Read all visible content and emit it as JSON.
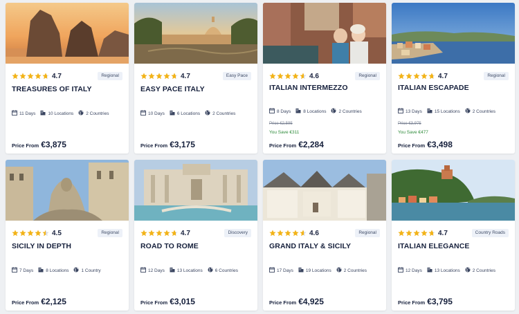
{
  "tours": [
    {
      "title": "TREASURES OF ITALY",
      "rating": "4.7",
      "tag": "Regional",
      "days": "11 Days",
      "locations": "10 Locations",
      "countries": "2 Countries",
      "price_label": "Price From",
      "price": "€3,875",
      "photo_alt": "sea-stacks-sunset"
    },
    {
      "title": "EASY PACE ITALY",
      "rating": "4.7",
      "tag": "Easy Pace",
      "days": "10 Days",
      "locations": "6 Locations",
      "countries": "2 Countries",
      "price_label": "Price From",
      "price": "€3,175",
      "photo_alt": "rome-river-dome"
    },
    {
      "title": "ITALIAN INTERMEZZO",
      "rating": "4.6",
      "tag": "Regional",
      "days": "8 Days",
      "locations": "8 Locations",
      "countries": "2 Countries",
      "was_price": "Price €2,595",
      "save": "You Save €311",
      "price_label": "Price From",
      "price": "€2,284",
      "photo_alt": "venice-canal-travelers"
    },
    {
      "title": "ITALIAN ESCAPADE",
      "rating": "4.7",
      "tag": "Regional",
      "days": "13 Days",
      "locations": "15 Locations",
      "countries": "2 Countries",
      "was_price": "Price €3,975",
      "save": "You Save €477",
      "price_label": "Price From",
      "price": "€3,498",
      "photo_alt": "coastal-town"
    },
    {
      "title": "SICILY IN DEPTH",
      "rating": "4.5",
      "tag": "Regional",
      "days": "7 Days",
      "locations": "8 Locations",
      "countries": "1 Country",
      "price_label": "Price From",
      "price": "€2,125",
      "photo_alt": "baroque-fountain"
    },
    {
      "title": "ROAD TO ROME",
      "rating": "4.7",
      "tag": "Discovery",
      "days": "12 Days",
      "locations": "13 Locations",
      "countries": "6 Countries",
      "price_label": "Price From",
      "price": "€3,015",
      "photo_alt": "trevi-fountain"
    },
    {
      "title": "GRAND ITALY & SICILY",
      "rating": "4.6",
      "tag": "Regional",
      "days": "17 Days",
      "locations": "19 Locations",
      "countries": "2 Countries",
      "price_label": "Price From",
      "price": "€4,925",
      "photo_alt": "trulli-houses"
    },
    {
      "title": "ITALIAN ELEGANCE",
      "rating": "4.7",
      "tag": "Country Roads",
      "days": "12 Days",
      "locations": "13 Locations",
      "countries": "2 Countries",
      "price_label": "Price From",
      "price": "€3,795",
      "photo_alt": "portofino-coast"
    }
  ],
  "colors": {
    "star": "#f2b318",
    "star_empty": "#d9dce3",
    "save": "#2e8b3a",
    "tag_bg": "#edf1f8",
    "text": "#16203c"
  }
}
